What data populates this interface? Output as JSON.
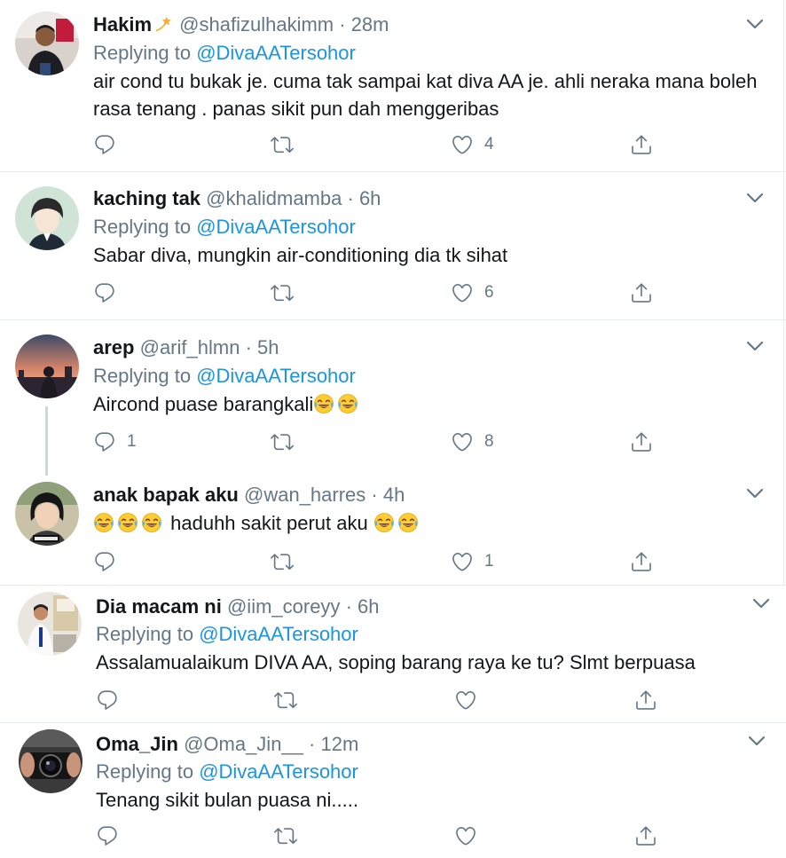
{
  "replying_prefix": "Replying to",
  "tweets": [
    {
      "name": "Hakim",
      "handle": "@shafizulhakimm",
      "separator": "·",
      "time": "28m",
      "reply_to": "@DivaAATersohor",
      "lines": [
        "air cond tu bukak je. cuma tak sampai kat diva AA je. ahli neraka mana boleh",
        "rasa tenang . panas sikit pun dah menggeribas"
      ],
      "reply_count": "",
      "retweet_count": "",
      "like_count": "4"
    },
    {
      "name": "kaching tak",
      "handle": "@khalidmamba",
      "separator": "·",
      "time": "6h",
      "reply_to": "@DivaAATersohor",
      "lines": [
        "Sabar diva, mungkin air-conditioning dia tk sihat"
      ],
      "reply_count": "",
      "retweet_count": "",
      "like_count": "6"
    },
    {
      "name": "arep",
      "handle": "@arif_hlmn",
      "separator": "·",
      "time": "5h",
      "reply_to": "@DivaAATersohor",
      "lines": [
        "Aircond puase barangkali"
      ],
      "reply_count": "1",
      "retweet_count": "",
      "like_count": "8"
    },
    {
      "name": "anak bapak aku",
      "handle": "@wan_harres",
      "separator": "·",
      "time": "4h",
      "reply_to": "",
      "lines": [
        "haduhh sakit perut aku"
      ],
      "reply_count": "",
      "retweet_count": "",
      "like_count": "1"
    },
    {
      "name": "Dia macam ni",
      "handle": "@iim_coreyy",
      "separator": "·",
      "time": "6h",
      "reply_to": "@DivaAATersohor",
      "lines": [
        "Assalamualaikum DIVA AA, soping barang raya ke tu? Slmt berpuasa"
      ],
      "reply_count": "",
      "retweet_count": "",
      "like_count": ""
    },
    {
      "name": "Oma_Jin",
      "handle": "@Oma_Jin__",
      "separator": "·",
      "time": "12m",
      "reply_to": "@DivaAATersohor",
      "lines": [
        "Tenang sikit bulan puasa ni....."
      ],
      "reply_count": "",
      "retweet_count": "",
      "like_count": ""
    }
  ],
  "icons": {
    "reply": "reply-icon",
    "retweet": "retweet-icon",
    "like": "heart-icon",
    "share": "share-icon",
    "more": "chevron-down-icon",
    "emoji": "tears-of-joy-emoji",
    "badge": "shooting-star-icon"
  },
  "colors": {
    "muted": "#657786",
    "mention": "#1b95e0",
    "divider": "#e6ecf0",
    "text": "#14171a"
  }
}
